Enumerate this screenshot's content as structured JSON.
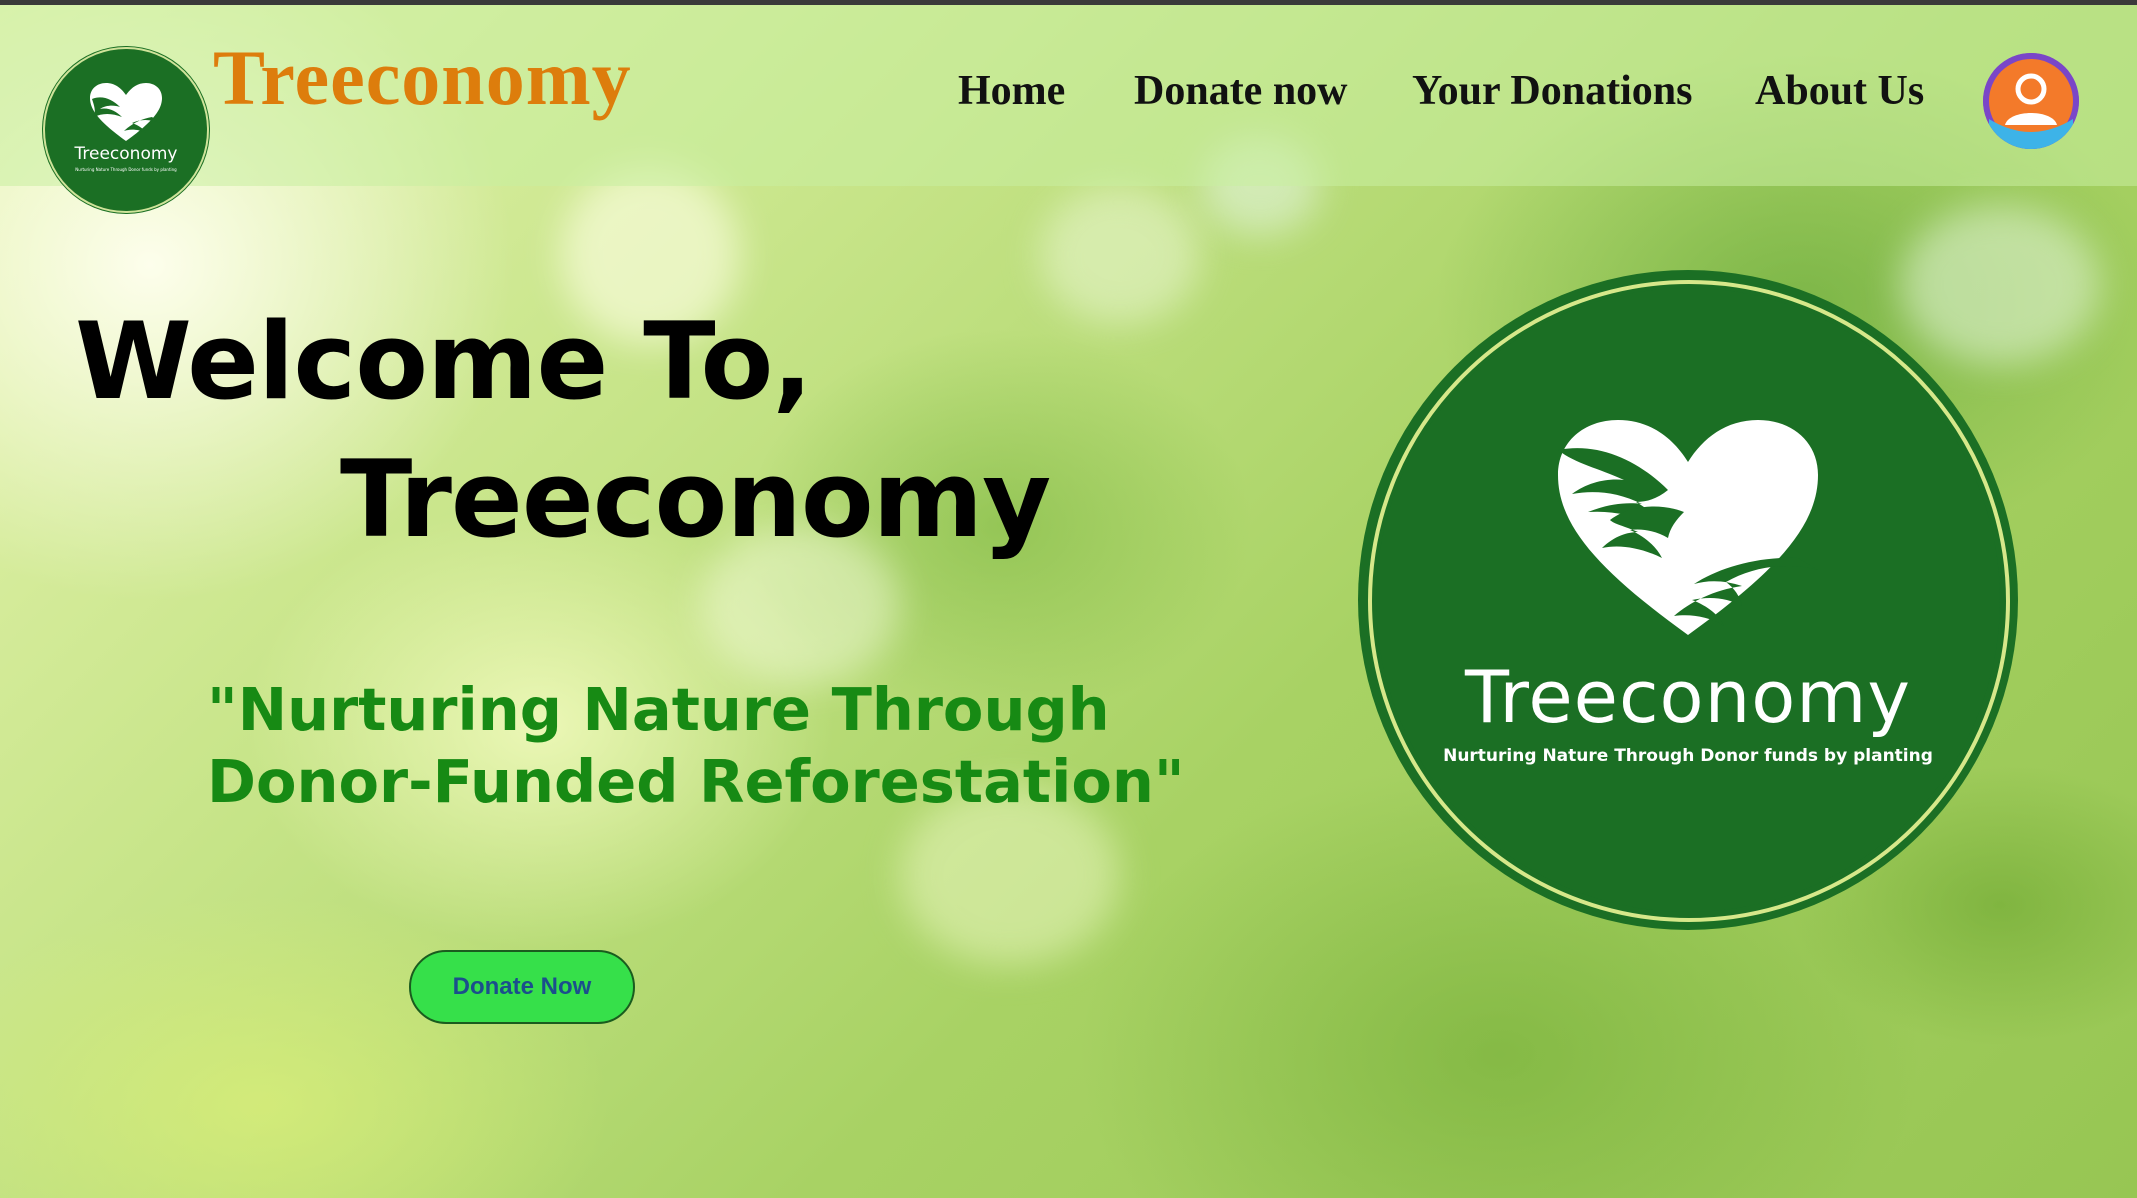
{
  "brand": {
    "title": "Treeconomy"
  },
  "logo_small": {
    "name": "Treeconomy",
    "tagline": "Nurturing Nature Through Donor funds by planting"
  },
  "nav": {
    "items": [
      {
        "label": "Home"
      },
      {
        "label": "Donate now"
      },
      {
        "label": "Your Donations"
      },
      {
        "label": "About Us"
      }
    ]
  },
  "hero": {
    "welcome_line1": "Welcome To,",
    "welcome_line2": "Treeconomy",
    "tagline": "\"Nurturing Nature Through Donor-Funded Reforestation\"",
    "donate_button": "Donate Now"
  },
  "logo_big": {
    "name": "Treeconomy",
    "tagline": "Nurturing Nature Through Donor funds by planting"
  },
  "icons": {
    "profile": "user-profile-icon",
    "logo": "heart-hands-icon"
  },
  "colors": {
    "brand_orange": "#dd7d0c",
    "logo_green": "#1b6f24",
    "tagline_green": "#178a14",
    "button_green": "#36e04a",
    "button_text": "#1b4f8c"
  }
}
